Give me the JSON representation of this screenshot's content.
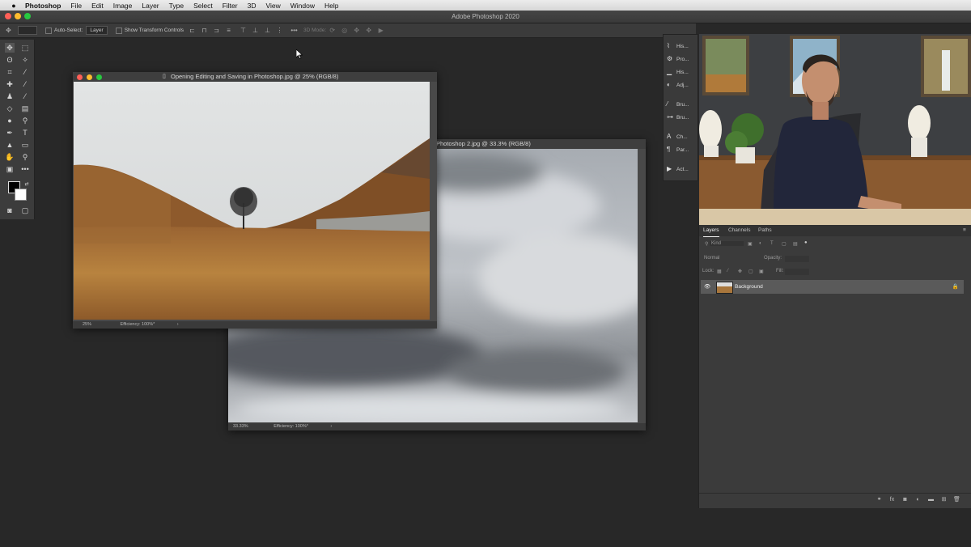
{
  "menubar": {
    "apple": "",
    "items": [
      "Photoshop",
      "File",
      "Edit",
      "Image",
      "Layer",
      "Type",
      "Select",
      "Filter",
      "3D",
      "View",
      "Window",
      "Help"
    ]
  },
  "window": {
    "title": "Adobe Photoshop 2020"
  },
  "options": {
    "auto_select_label": "Auto-Select:",
    "auto_select_value": "Layer",
    "transform_label": "Show Transform Controls",
    "mode_3d_label": "3D Mode:"
  },
  "doc1": {
    "title": "Opening Editing and Saving in Photoshop.jpg @ 25% (RGB/8)",
    "zoom": "25%",
    "efficiency": "Efficiency: 100%*"
  },
  "doc2": {
    "title": "Photoshop 2.jpg @ 33.3% (RGB/8)",
    "zoom": "33.33%",
    "efficiency": "Efficiency: 100%*"
  },
  "panels": [
    "His...",
    "Pro...",
    "His...",
    "Adj...",
    "Bru...",
    "Bru...",
    "Ch...",
    "Par...",
    "Act..."
  ],
  "layers_panel": {
    "tabs": [
      "Layers",
      "Channels",
      "Paths"
    ],
    "filter_placeholder": "Kind",
    "blend_mode": "Normal",
    "opacity_label": "Opacity:",
    "lock_label": "Lock:",
    "fill_label": "Fill:",
    "layer_name": "Background"
  },
  "colors": {
    "accent": "#3b3b3b",
    "traffic_red": "#ff5f57",
    "traffic_yellow": "#febc2e",
    "traffic_green": "#28c840"
  }
}
